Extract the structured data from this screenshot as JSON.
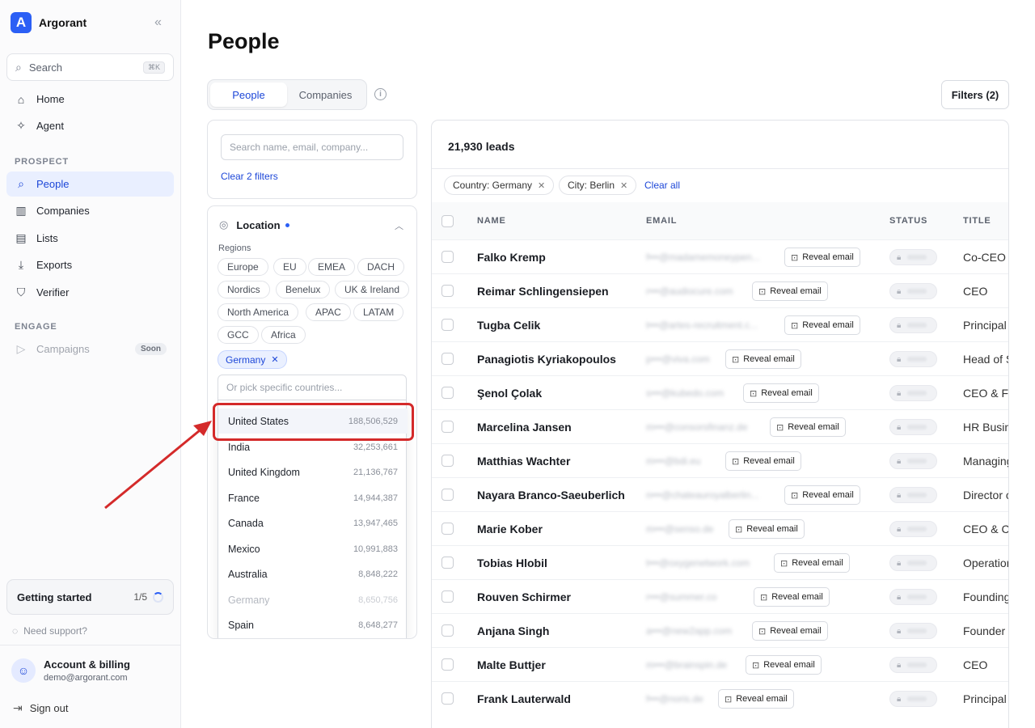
{
  "sidebar": {
    "brand": "Argorant",
    "brand_letter": "A",
    "search_label": "Search",
    "search_kbd": "⌘K",
    "items": [
      {
        "label": "Home",
        "icon": "home-icon"
      },
      {
        "label": "Agent",
        "icon": "sparkle-icon"
      }
    ],
    "prospect_label": "PROSPECT",
    "prospect_items": [
      {
        "label": "People",
        "icon": "search-icon",
        "active": true
      },
      {
        "label": "Companies",
        "icon": "building-icon"
      },
      {
        "label": "Lists",
        "icon": "book-icon"
      },
      {
        "label": "Exports",
        "icon": "download-icon"
      },
      {
        "label": "Verifier",
        "icon": "shield-icon"
      }
    ],
    "engage_label": "ENGAGE",
    "engage_items": [
      {
        "label": "Campaigns",
        "icon": "send-icon",
        "badge": "Soon"
      }
    ],
    "getting_started": {
      "label": "Getting started",
      "progress": "1/5"
    },
    "support": "Need support?",
    "account": {
      "name": "Account & billing",
      "email": "demo@argorant.com"
    },
    "signout": "Sign out"
  },
  "page": {
    "title": "People",
    "tabs": [
      "People",
      "Companies"
    ],
    "filters_button": "Filters (2)"
  },
  "filter_panel": {
    "search_placeholder": "Search name, email, company...",
    "clear_filters": "Clear 2 filters",
    "location": {
      "title": "Location",
      "regions_label": "Regions",
      "regions": [
        "Europe",
        "EU",
        "EMEA",
        "DACH",
        "Nordics",
        "Benelux",
        "UK & Ireland",
        "North America",
        "APAC",
        "LATAM",
        "GCC",
        "Africa"
      ],
      "selected": "Germany",
      "pick_placeholder": "Or pick specific countries...",
      "countries": [
        {
          "name": "United States",
          "count": "188,506,529"
        },
        {
          "name": "India",
          "count": "32,253,661"
        },
        {
          "name": "United Kingdom",
          "count": "21,136,767"
        },
        {
          "name": "France",
          "count": "14,944,387"
        },
        {
          "name": "Canada",
          "count": "13,947,465"
        },
        {
          "name": "Mexico",
          "count": "10,991,883"
        },
        {
          "name": "Australia",
          "count": "8,848,222"
        },
        {
          "name": "Germany",
          "count": "8,650,756"
        },
        {
          "name": "Spain",
          "count": "8,648,277"
        }
      ]
    }
  },
  "leads": {
    "count": "21,930 leads",
    "active_filters": [
      "Country: Germany",
      "City: Berlin"
    ],
    "clear_all": "Clear all",
    "columns": [
      "NAME",
      "EMAIL",
      "STATUS",
      "TITLE"
    ],
    "reveal_label": "Reveal email",
    "rows": [
      {
        "name": "Falko Kremp",
        "email": "f•••@madamemoneypen...",
        "title": "Co-CEO"
      },
      {
        "name": "Reimar Schlingensiepen",
        "email": "r•••@audiocure.com",
        "title": "CEO"
      },
      {
        "name": "Tugba Celik",
        "email": "t•••@artes-recruitment.c...",
        "title": "Principal"
      },
      {
        "name": "Panagiotis Kyriakopoulos",
        "email": "p•••@viva.com",
        "title": "Head of S"
      },
      {
        "name": "Şenol Çolak",
        "email": "s•••@kubedo.com",
        "title": "CEO & Fo"
      },
      {
        "name": "Marcelina Jansen",
        "email": "m•••@consorsfinanz.de",
        "title": "HR Busin"
      },
      {
        "name": "Matthias Wachter",
        "email": "m•••@bdi.eu",
        "title": "Managing"
      },
      {
        "name": "Nayara Branco-Saeuberlich",
        "email": "n•••@chateauroyalberlin...",
        "title": "Director o"
      },
      {
        "name": "Marie Kober",
        "email": "m•••@senso.de",
        "title": "CEO & Co"
      },
      {
        "name": "Tobias Hlobil",
        "email": "t•••@oxygenetwork.com",
        "title": "Operation"
      },
      {
        "name": "Rouven Schirmer",
        "email": "r•••@summer.co",
        "title": "Founding"
      },
      {
        "name": "Anjana Singh",
        "email": "a•••@new2app.com",
        "title": "Founder &"
      },
      {
        "name": "Malte Buttjer",
        "email": "m•••@brainspin.de",
        "title": "CEO"
      },
      {
        "name": "Frank Lauterwald",
        "email": "f•••@noris.de",
        "title": "Principal"
      }
    ]
  },
  "colors": {
    "accent": "#2b5ff5",
    "highlight": "#d42a2a"
  }
}
